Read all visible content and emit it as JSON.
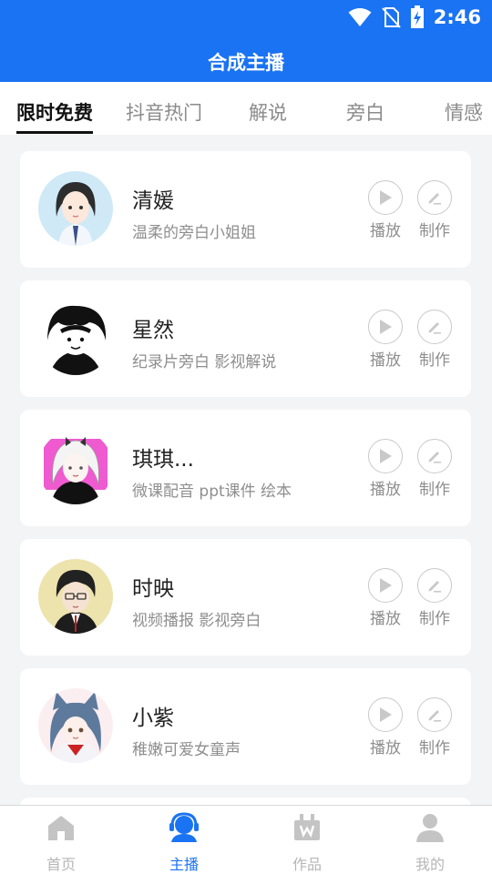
{
  "status_bar": {
    "time": "2:46",
    "icons": [
      "wifi-icon",
      "no-sim-icon",
      "battery-charging-icon"
    ]
  },
  "app_bar": {
    "title": "合成主播"
  },
  "tabs": [
    {
      "label": "限时免费",
      "active": true
    },
    {
      "label": "抖音热门"
    },
    {
      "label": "解说"
    },
    {
      "label": "旁白"
    },
    {
      "label": "情感"
    }
  ],
  "anchors": [
    {
      "name": "清媛",
      "desc": "温柔的旁白小姐姐",
      "play_label": "播放",
      "edit_label": "制作"
    },
    {
      "name": "星然",
      "desc": "纪录片旁白  影视解说",
      "play_label": "播放",
      "edit_label": "制作"
    },
    {
      "name": "琪琪...",
      "desc": "微课配音 ppt课件 绘本",
      "play_label": "播放",
      "edit_label": "制作"
    },
    {
      "name": "时映",
      "desc": "视频播报  影视旁白",
      "play_label": "播放",
      "edit_label": "制作"
    },
    {
      "name": "小紫",
      "desc": "稚嫩可爱女童声",
      "play_label": "播放",
      "edit_label": "制作"
    }
  ],
  "bottom_nav": [
    {
      "label": "首页",
      "icon": "home-icon"
    },
    {
      "label": "主播",
      "icon": "headset-icon",
      "active": true
    },
    {
      "label": "作品",
      "icon": "works-box-icon"
    },
    {
      "label": "我的",
      "icon": "profile-icon"
    }
  ],
  "colors": {
    "primary": "#1a73f2",
    "background": "#f3f4f6"
  }
}
